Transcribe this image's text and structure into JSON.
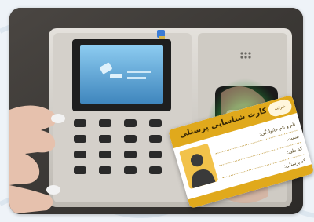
{
  "card": {
    "title": "کارت شناسایی پرسنلی",
    "logo_text": "شرکت",
    "fields": [
      {
        "label": "نام و نام خانوادگی:"
      },
      {
        "label": "سمت:"
      },
      {
        "label": "کد ملی:"
      },
      {
        "label": "کد پرسنلی:"
      }
    ]
  },
  "colors": {
    "device_body": "#dcd9d3",
    "screen": "#5fa8d8",
    "fingerprint_glow": "#3fdc5a",
    "card_accent": "#e0a91c"
  }
}
